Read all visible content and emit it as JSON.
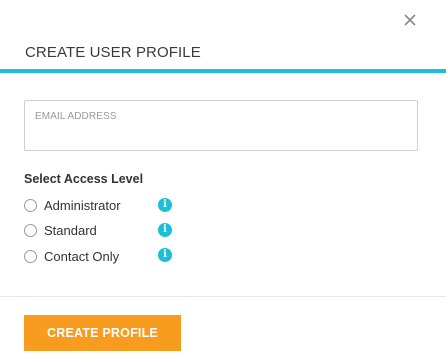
{
  "dialog": {
    "title": "CREATE USER PROFILE",
    "close_icon": "close-icon",
    "accent_color": "#1bbfd7"
  },
  "email": {
    "label": "EMAIL ADDRESS",
    "value": "",
    "placeholder": ""
  },
  "access_level": {
    "label": "Select Access Level",
    "options": [
      {
        "label": "Administrator",
        "selected": false,
        "info_icon": "info-icon"
      },
      {
        "label": "Standard",
        "selected": false,
        "info_icon": "info-icon"
      },
      {
        "label": "Contact Only",
        "selected": false,
        "info_icon": "info-icon"
      }
    ]
  },
  "footer": {
    "create_label": "CREATE PROFILE",
    "button_color": "#f79c1e"
  }
}
